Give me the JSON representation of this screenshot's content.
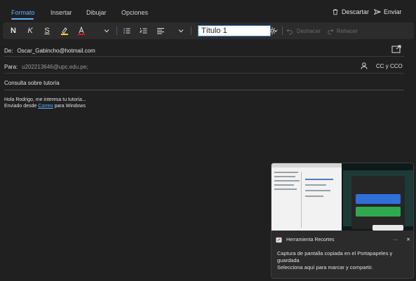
{
  "tabs": [
    "Formato",
    "Insertar",
    "Dibujar",
    "Opciones"
  ],
  "actions": {
    "discard": "Descartar",
    "send": "Enviar"
  },
  "toolbar": {
    "bold": "N",
    "italic": "K",
    "underline": "S",
    "style_value": "Título 1",
    "undo": "Deshacer",
    "redo": "Rehacer"
  },
  "header": {
    "from_label": "De:",
    "from_address": "Oscar_Gabincho@hotmail.com",
    "to_label": "Para:",
    "to_address": "u202213646@upc.edu.pe;",
    "cc_label": "CC y CCO",
    "subject": "Consulta sobre tutoría"
  },
  "body": {
    "line1": "Hola Rodrigo, me interesa tu tutoría...",
    "line2_prefix": "Enviado desde",
    "line2_link": "Correo",
    "line2_suffix": "para Windows"
  },
  "toast": {
    "app_name": "Herramienta Recortes",
    "more": "···",
    "close": "✕",
    "message1": "Captura de pantalla copiada en el Portapapeles y guardada",
    "message2": "Selecciona aquí para marcar y compartir."
  },
  "colors": {
    "accent": "#5fb0ff",
    "highlight": "#ffd500",
    "font_color": "#e81123",
    "background": "#202020"
  }
}
